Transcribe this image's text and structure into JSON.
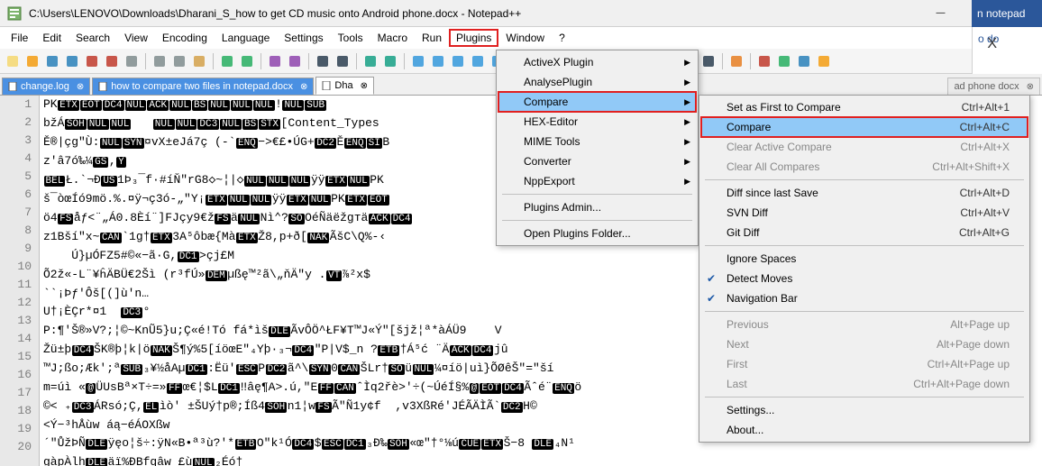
{
  "title": "C:\\Users\\LENOVO\\Downloads\\Dharani_S_how to get CD music onto Android phone.docx - Notepad++",
  "win_buttons": {
    "min": "—",
    "max": "☐",
    "close": "✕"
  },
  "menubar": [
    "File",
    "Edit",
    "Search",
    "View",
    "Encoding",
    "Language",
    "Settings",
    "Tools",
    "Macro",
    "Run",
    "Plugins",
    "Window",
    "?"
  ],
  "menubar_highlight_index": 10,
  "close_right_label": "X",
  "tabs": [
    {
      "label": "change.log",
      "kind": "blue"
    },
    {
      "label": "how to compare two files in notepad.docx",
      "kind": "blue"
    },
    {
      "label": "Dha",
      "kind": "active"
    }
  ],
  "right_partial_tab": "ad phone docx",
  "toolbar_icons": [
    "new",
    "open",
    "save",
    "save-all",
    "close-doc",
    "close-all",
    "print",
    "sep",
    "cut",
    "copy",
    "paste",
    "sep",
    "undo",
    "redo",
    "sep",
    "find",
    "replace",
    "sep",
    "zoom-in",
    "zoom-out",
    "sep",
    "sync-v",
    "sync-h",
    "sep",
    "wrap",
    "show-all",
    "indent",
    "fold",
    "unfold",
    "sep",
    "folder",
    "doc-list",
    "doc-map",
    "func-list",
    "sep",
    "monitor",
    "sep",
    "rec",
    "play",
    "sep",
    "rec2",
    "stop",
    "sep",
    "pref",
    "sep",
    "p1",
    "p2",
    "p3",
    "p4"
  ],
  "plugins_menu": [
    {
      "label": "ActiveX Plugin",
      "arrow": true
    },
    {
      "label": "AnalysePlugin",
      "arrow": true
    },
    {
      "label": "Compare",
      "arrow": true,
      "hov": true,
      "hl": true
    },
    {
      "label": "HEX-Editor",
      "arrow": true
    },
    {
      "label": "MIME Tools",
      "arrow": true
    },
    {
      "label": "Converter",
      "arrow": true
    },
    {
      "label": "NppExport",
      "arrow": true
    },
    {
      "sep": true
    },
    {
      "label": "Plugins Admin..."
    },
    {
      "sep": true
    },
    {
      "label": "Open Plugins Folder..."
    }
  ],
  "compare_menu": [
    {
      "label": "Set as First to Compare",
      "shortcut": "Ctrl+Alt+1"
    },
    {
      "label": "Compare",
      "shortcut": "Ctrl+Alt+C",
      "hov": true,
      "hl": true
    },
    {
      "label": "Clear Active Compare",
      "shortcut": "Ctrl+Alt+X",
      "disabled": true
    },
    {
      "label": "Clear All Compares",
      "shortcut": "Ctrl+Alt+Shift+X",
      "disabled": true
    },
    {
      "sep": true
    },
    {
      "label": "Diff since last Save",
      "shortcut": "Ctrl+Alt+D"
    },
    {
      "label": "SVN Diff",
      "shortcut": "Ctrl+Alt+V"
    },
    {
      "label": "Git Diff",
      "shortcut": "Ctrl+Alt+G"
    },
    {
      "sep": true
    },
    {
      "label": "Ignore Spaces"
    },
    {
      "label": "Detect Moves",
      "check": true
    },
    {
      "label": "Navigation Bar",
      "check": true
    },
    {
      "sep": true
    },
    {
      "label": "Previous",
      "shortcut": "Alt+Page up",
      "disabled": true
    },
    {
      "label": "Next",
      "shortcut": "Alt+Page down",
      "disabled": true
    },
    {
      "label": "First",
      "shortcut": "Ctrl+Alt+Page up",
      "disabled": true
    },
    {
      "label": "Last",
      "shortcut": "Ctrl+Alt+Page down",
      "disabled": true
    },
    {
      "sep": true
    },
    {
      "label": "Settings..."
    },
    {
      "label": "About..."
    }
  ],
  "lines": [
    [
      [
        "PK"
      ],
      [
        "inv",
        "ETX"
      ],
      [
        "inv",
        "EOT"
      ],
      [
        "inv",
        "DC4"
      ],
      [
        "inv",
        "NUL"
      ],
      [
        "inv",
        "ACK"
      ],
      [
        "inv",
        "NUL"
      ],
      [
        "inv",
        "BS"
      ],
      [
        "inv",
        "NUL"
      ],
      [
        "inv",
        "NUL"
      ],
      [
        "inv",
        "NUL"
      ],
      [
        "!"
      ],
      [
        "inv",
        "NUL"
      ],
      [
        "inv",
        "SUB"
      ]
    ],
    [
      [
        "bžÁ"
      ],
      [
        "inv",
        "SOH"
      ],
      [
        "inv",
        "NUL"
      ],
      [
        "inv",
        "NUL"
      ],
      [
        "   "
      ],
      [
        "inv",
        "NUL"
      ],
      [
        "inv",
        "NUL"
      ],
      [
        "inv",
        "DC3"
      ],
      [
        "inv",
        "NUL"
      ],
      [
        "inv",
        "BS"
      ],
      [
        "inv",
        "STX"
      ],
      [
        "[Content_Types"
      ]
    ],
    [
      [
        "Ě®|çg\"Ù:"
      ],
      [
        "inv",
        "NUL"
      ],
      [
        "inv",
        "SYN"
      ],
      [
        "¤vX±eJá7ç (-`"
      ],
      [
        "inv",
        "ENQ"
      ],
      [
        "−>€£•ÚG+"
      ],
      [
        "inv",
        "DC2"
      ],
      [
        "Ě"
      ],
      [
        "inv",
        "ENQ"
      ],
      [
        "inv",
        "SI"
      ],
      [
        "B"
      ]
    ],
    [
      [
        "z'â7ó‰¼"
      ],
      [
        "inv",
        "GS"
      ],
      [
        ","
      ],
      [
        "inv",
        "Y"
      ]
    ],
    [
      [
        "inv",
        "BEL"
      ],
      [
        "Ł.`¬Ð"
      ],
      [
        "inv",
        "US"
      ],
      [
        "1Þ₃¯f·#íŇ\"rG8◇~¦|◇"
      ],
      [
        "inv",
        "NUL"
      ],
      [
        "inv",
        "NUL"
      ],
      [
        "inv",
        "NUL"
      ],
      [
        "ÿÿ"
      ],
      [
        "inv",
        "ETX"
      ],
      [
        "inv",
        "NUL"
      ],
      [
        "PK"
      ]
    ],
    [
      [
        "š¯òœÍó9mö.%.¤ÿ¬ç3ó-„\"Y¡"
      ],
      [
        "inv",
        "ETX"
      ],
      [
        "inv",
        "NUL"
      ],
      [
        "inv",
        "NUL"
      ],
      [
        "ÿÿ"
      ],
      [
        "inv",
        "ETX"
      ],
      [
        "inv",
        "NUL"
      ],
      [
        "PK"
      ],
      [
        "inv",
        "ETX"
      ],
      [
        "inv",
        "EOT"
      ]
    ],
    [
      [
        "ö4"
      ],
      [
        "inv",
        "FS"
      ],
      [
        "åƒ<¨„Á0.8Èí¨]FJçy9€ž"
      ],
      [
        "inv",
        "FS"
      ],
      [
        "ä"
      ],
      [
        "inv",
        "NUL"
      ],
      [
        "Nì⌃?"
      ],
      [
        "inv",
        "SO"
      ],
      [
        "OéÑ"
      ],
      [
        "äëžgтä"
      ],
      [
        "inv",
        "ACK"
      ],
      [
        "inv",
        "DC4"
      ]
    ],
    [
      [
        "z1Bší\"x~"
      ],
      [
        "inv",
        "CAN"
      ],
      [
        "`1g†"
      ],
      [
        "inv",
        "ETX"
      ],
      [
        "3A⁵ôbæ{Mà"
      ],
      [
        "inv",
        "ETX"
      ],
      [
        "Ž8,p+ð["
      ],
      [
        "inv",
        "NAK"
      ],
      [
        "ÃšC\\Q%-‹"
      ]
    ],
    [
      [
        "    Ú}µÓFZ5#©«−ã·G,"
      ],
      [
        "inv",
        "DC1"
      ],
      [
        ">çj£M"
      ]
    ],
    [
      [
        "Õ2ž«-L¨¥ĥÄBÜ€2Šì (r³fÚ»"
      ],
      [
        "inv",
        "DEM"
      ],
      [
        "µßę™²ã\\„ňÄ\"y ."
      ],
      [
        "inv",
        "VT"
      ],
      [
        "⅞²x$"
      ]
    ],
    [
      [
        "``¡Þƒ'Ôš[(]ù'n…"
      ]
    ],
    [
      [
        "U†¡ÈÇr*¤1  "
      ],
      [
        "inv",
        "DC3"
      ],
      [
        "°"
      ]
    ],
    [
      [
        "P:¶'Š®»V?;¦©~KnŨ5}u;Ç«é!Tó fá*ìš"
      ],
      [
        "inv",
        "DLE"
      ],
      [
        "ÃvÔÖ^ŁF¥T™J«Ý\"[šjž¦ª*àÁÜ9    V"
      ]
    ],
    [
      [
        "Žü±þ"
      ],
      [
        "inv",
        "DC4"
      ],
      [
        "ŠK®þ¦k|ö"
      ],
      [
        "inv",
        "NAK"
      ],
      [
        "Š¶ý%5[íöœE\"₄Yþ·₃¬"
      ],
      [
        "inv",
        "DC4"
      ],
      [
        "\"P|V$_n ?"
      ],
      [
        "inv",
        "ETB"
      ],
      [
        "†Á⁵ć ¨Ä"
      ],
      [
        "inv",
        "ACK"
      ],
      [
        "inv",
        "DC4"
      ],
      [
        "jû"
      ]
    ],
    [
      [
        "™J;ßo;Æk';ª"
      ],
      [
        "inv",
        "SUB"
      ],
      [
        "₃¥½åAµ"
      ],
      [
        "inv",
        "DC1"
      ],
      [
        ":Ëü'"
      ],
      [
        "inv",
        "ESC"
      ],
      [
        "P"
      ],
      [
        "inv",
        "DC2"
      ],
      [
        "ã^\\"
      ],
      [
        "inv",
        "SYN"
      ],
      [
        "0"
      ],
      [
        "inv",
        "CAN"
      ],
      [
        "ŠLr†"
      ],
      [
        "inv",
        "SO"
      ],
      [
        "ü"
      ],
      [
        "inv",
        "NUL"
      ],
      [
        "¼¤íö|uì}ÕØêŠ\"=\"ší"
      ]
    ],
    [
      [
        "m=úì «"
      ],
      [
        "inv",
        "@"
      ],
      [
        "ÜUsBª×T÷=»"
      ],
      [
        "inv",
        "FF"
      ],
      [
        "œ€¦$L"
      ],
      [
        "inv",
        "DC1"
      ],
      [
        "‼âę¶A>.ú,\"E"
      ],
      [
        "inv",
        "FF"
      ],
      [
        "inv",
        "CAN"
      ],
      [
        "ˆÌq2řè>'÷(~ÚéÍ§%"
      ],
      [
        "inv",
        "@"
      ],
      [
        "inv",
        "EOT"
      ],
      [
        "inv",
        "DC4"
      ],
      [
        "Ãˆé¨"
      ],
      [
        "inv",
        "ENQ"
      ],
      [
        "ö"
      ]
    ],
    [
      [
        "©< ₊"
      ],
      [
        "inv",
        "DC3"
      ],
      [
        "ÁRsó;Ç,"
      ],
      [
        "inv",
        "EL"
      ],
      [
        "ìò′ ±ŠUý†p®;Íß4"
      ],
      [
        "inv",
        "SOH"
      ],
      [
        "n1¦w"
      ],
      [
        "inv",
        "FS"
      ],
      [
        "Ã\"Ñ1y¢f  ,v3XßRé'JÉÃÄÌÃ`"
      ],
      [
        "inv",
        "DC2"
      ],
      [
        "H©"
      ]
    ],
    [
      [
        "<Ý−³hÅùw áą−éÁOXßw"
      ]
    ],
    [
      [
        "´\"ŮžÞÑ"
      ],
      [
        "inv",
        "DLE"
      ],
      [
        "ÿęo¦š÷:ÿN«B•ª³ù?'*"
      ],
      [
        "inv",
        "ETB"
      ],
      [
        "O\"k¹Ó"
      ],
      [
        "inv",
        "DC4"
      ],
      [
        "$"
      ],
      [
        "inv",
        "ESC"
      ],
      [
        "inv",
        "DC1"
      ],
      [
        "₃Ð‰"
      ],
      [
        "inv",
        "SOH"
      ],
      [
        "«œ″†°⅛ú"
      ],
      [
        "inv",
        "CUE"
      ],
      [
        "inv",
        "ETX"
      ],
      [
        "Š−8 "
      ],
      [
        "inv",
        "DLE"
      ],
      [
        "₄N¹"
      ]
    ],
    [
      [
        "gàpÀlh"
      ],
      [
        "inv",
        "DLE"
      ],
      [
        "äï%ÐBfqâw £ù"
      ],
      [
        "inv",
        "NUL"
      ],
      [
        "₂Éó†"
      ]
    ]
  ],
  "line_count": 20,
  "right_word_fragment": "n notepad",
  "right_blue_text": "o do"
}
